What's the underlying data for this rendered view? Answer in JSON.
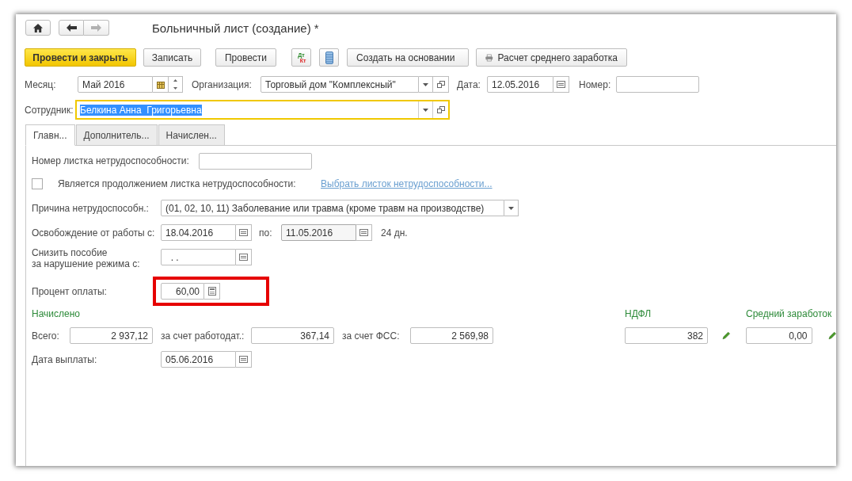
{
  "window": {
    "title": "Больничный лист (создание) *"
  },
  "navigation": [
    {
      "kind": "home",
      "disabled": false
    },
    {
      "kind": "back",
      "disabled": false
    },
    {
      "kind": "forward",
      "disabled": true
    }
  ],
  "toolbar": [
    {
      "kind": "primary",
      "label": "Провести и закрыть"
    },
    {
      "kind": "text",
      "label": "Записать"
    },
    {
      "kind": "text",
      "label": "Провести"
    },
    {
      "kind": "dtkt",
      "label_top": "Дт",
      "label_bottom": "Кт"
    },
    {
      "kind": "register"
    },
    {
      "kind": "menu",
      "label": "Создать на основании"
    },
    {
      "kind": "report",
      "label": "Расчет среднего заработка"
    }
  ],
  "header": {
    "month": {
      "label": "Месяц:",
      "value": "Май 2016"
    },
    "organization": {
      "label": "Организация:",
      "value": "Торговый дом \"Комплексный\""
    },
    "date": {
      "label": "Дата:",
      "value": "12.05.2016"
    },
    "number": {
      "label": "Номер:"
    },
    "employee": {
      "label": "Сотрудник:",
      "value": "Белкина Анна  Григорьевна",
      "selected": true
    }
  },
  "tabs": [
    {
      "label": "Главн...",
      "selected": true
    },
    {
      "label": "Дополнитель...",
      "selected": false
    },
    {
      "label": "Начислен...",
      "selected": false
    }
  ],
  "main": {
    "sheet_number": {
      "label": "Номер листка нетрудоспособности:"
    },
    "continuation": {
      "label": "Является продолжением листка нетрудоспособности:",
      "checked": false,
      "link": "Выбрать листок нетрудоспособности..."
    },
    "reason": {
      "label": "Причина нетрудоспособн.:",
      "value": "(01, 02, 10, 11) Заболевание или травма (кроме травм на производстве)"
    },
    "release": {
      "label": "Освобождение от работы с:",
      "from": "18.04.2016",
      "to_label": "по:",
      "to": "11.05.2016",
      "days": "24 дн."
    },
    "reduce": {
      "label": "Снизить пособие\nза нарушение режима с:",
      "value": ". ."
    },
    "percent": {
      "label": "Процент оплаты:",
      "value": "60,00",
      "highlighted": true
    },
    "accrued": {
      "title": "Начислено",
      "total_label": "Всего:",
      "total": "2 937,12",
      "employer_label": "за счет работодат.:",
      "employer": "367,14",
      "fss_label": "за счет ФСС:",
      "fss": "2 569,98"
    },
    "ndfl": {
      "title": "НДФЛ",
      "value": "382"
    },
    "average": {
      "title": "Средний заработок",
      "value": "0,00"
    },
    "payment_date": {
      "label": "Дата выплаты:",
      "value": "05.06.2016"
    }
  }
}
